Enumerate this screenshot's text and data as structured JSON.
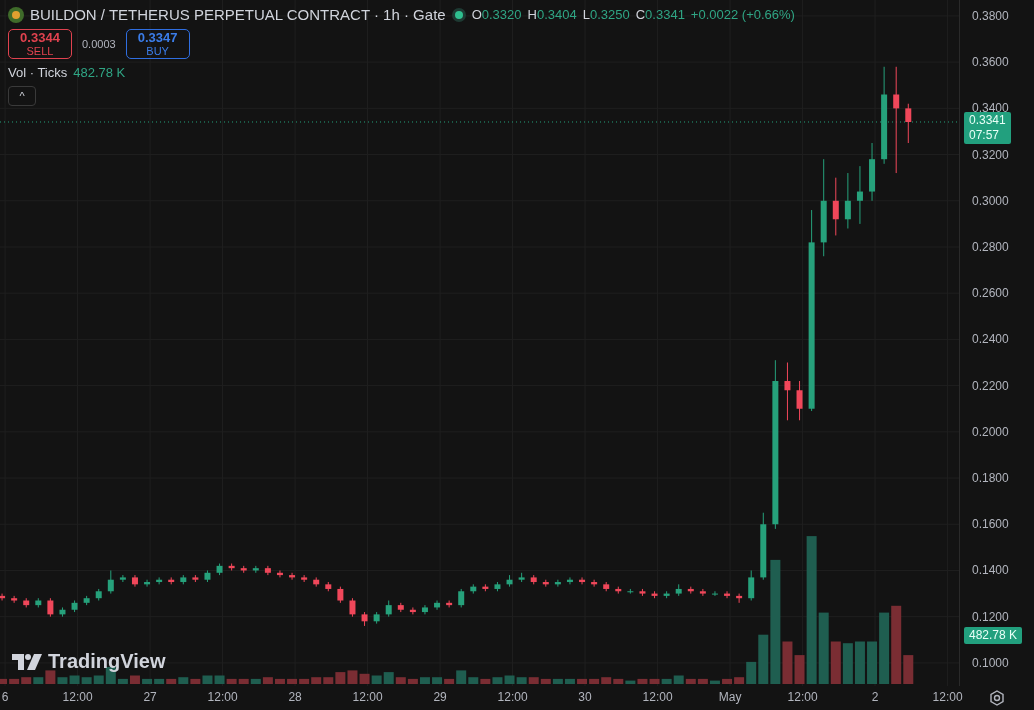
{
  "header": {
    "symbol": "BUILDON / TETHERUS PERPETUAL CONTRACT · 1h · Gate",
    "market_open": true,
    "ohlc": [
      {
        "label": "O",
        "value": "0.3320"
      },
      {
        "label": "H",
        "value": "0.3404"
      },
      {
        "label": "L",
        "value": "0.3250"
      },
      {
        "label": "C",
        "value": "0.3341"
      }
    ],
    "change": "+0.0022 (+0.66%)"
  },
  "trade": {
    "sell": {
      "price": "0.3344",
      "label": "SELL"
    },
    "spread": "0.0003",
    "buy": {
      "price": "0.3347",
      "label": "BUY"
    }
  },
  "volume_legend": {
    "label": "Vol · Ticks",
    "value": "482.78 K"
  },
  "collapse_button": "^",
  "last_price": {
    "price": "0.3341",
    "countdown": "07:57"
  },
  "volume_tag": "482.78 K",
  "watermark_brand": "TradingView",
  "time_axis": [
    "6",
    "12:00",
    "27",
    "12:00",
    "28",
    "12:00",
    "29",
    "12:00",
    "30",
    "12:00",
    "May",
    "12:00",
    "2",
    "12:00"
  ],
  "chart_data": {
    "type": "candlestick",
    "ylim": [
      0.09,
      0.3869
    ],
    "yticks": [
      {
        "value": 0.38,
        "label": "0.3800"
      },
      {
        "value": 0.36,
        "label": "0.3600"
      },
      {
        "value": 0.34,
        "label": "0.3400"
      },
      {
        "value": 0.32,
        "label": "0.3200"
      },
      {
        "value": 0.3,
        "label": "0.3000"
      },
      {
        "value": 0.28,
        "label": "0.2800"
      },
      {
        "value": 0.26,
        "label": "0.2600"
      },
      {
        "value": 0.24,
        "label": "0.2400"
      },
      {
        "value": 0.22,
        "label": "0.2200"
      },
      {
        "value": 0.2,
        "label": "0.2000"
      },
      {
        "value": 0.18,
        "label": "0.1800"
      },
      {
        "value": 0.16,
        "label": "0.1600"
      },
      {
        "value": 0.14,
        "label": "0.1400"
      },
      {
        "value": 0.12,
        "label": "0.1200"
      },
      {
        "value": 0.1,
        "label": "0.1000"
      }
    ],
    "categories": [
      null,
      null,
      null,
      null,
      null,
      null,
      null,
      null,
      null,
      null,
      null,
      null,
      null,
      null,
      null,
      null,
      null,
      null,
      null,
      null,
      null,
      null,
      null,
      null,
      null,
      null,
      null,
      null,
      null,
      null,
      null,
      null,
      null,
      null,
      null,
      null,
      null,
      null,
      null,
      null,
      null,
      null,
      null,
      null,
      null,
      null,
      null,
      null,
      null,
      null,
      null,
      null,
      null,
      null,
      null,
      null,
      null,
      null,
      null,
      null,
      null,
      null,
      null,
      null,
      null,
      null,
      null,
      null,
      null,
      null,
      null,
      null,
      null,
      null,
      null,
      null
    ],
    "ohlc": [
      [
        0.129,
        0.13,
        0.127,
        0.128
      ],
      [
        0.128,
        0.129,
        0.126,
        0.127
      ],
      [
        0.127,
        0.128,
        0.124,
        0.125
      ],
      [
        0.125,
        0.128,
        0.124,
        0.127
      ],
      [
        0.127,
        0.128,
        0.12,
        0.121
      ],
      [
        0.121,
        0.124,
        0.12,
        0.123
      ],
      [
        0.123,
        0.127,
        0.122,
        0.126
      ],
      [
        0.126,
        0.129,
        0.125,
        0.128
      ],
      [
        0.128,
        0.132,
        0.127,
        0.131
      ],
      [
        0.131,
        0.14,
        0.13,
        0.136
      ],
      [
        0.136,
        0.138,
        0.135,
        0.137
      ],
      [
        0.137,
        0.138,
        0.133,
        0.134
      ],
      [
        0.134,
        0.136,
        0.133,
        0.135
      ],
      [
        0.135,
        0.137,
        0.134,
        0.136
      ],
      [
        0.136,
        0.137,
        0.134,
        0.135
      ],
      [
        0.135,
        0.138,
        0.134,
        0.137
      ],
      [
        0.137,
        0.138,
        0.135,
        0.136
      ],
      [
        0.136,
        0.14,
        0.135,
        0.139
      ],
      [
        0.139,
        0.143,
        0.138,
        0.142
      ],
      [
        0.142,
        0.143,
        0.14,
        0.141
      ],
      [
        0.141,
        0.142,
        0.139,
        0.14
      ],
      [
        0.14,
        0.142,
        0.139,
        0.141
      ],
      [
        0.141,
        0.142,
        0.138,
        0.139
      ],
      [
        0.139,
        0.14,
        0.137,
        0.138
      ],
      [
        0.138,
        0.139,
        0.136,
        0.137
      ],
      [
        0.137,
        0.138,
        0.135,
        0.136
      ],
      [
        0.136,
        0.137,
        0.133,
        0.134
      ],
      [
        0.134,
        0.135,
        0.131,
        0.132
      ],
      [
        0.132,
        0.133,
        0.126,
        0.127
      ],
      [
        0.127,
        0.128,
        0.12,
        0.121
      ],
      [
        0.121,
        0.122,
        0.116,
        0.118
      ],
      [
        0.118,
        0.122,
        0.117,
        0.121
      ],
      [
        0.121,
        0.127,
        0.12,
        0.125
      ],
      [
        0.125,
        0.126,
        0.122,
        0.123
      ],
      [
        0.123,
        0.124,
        0.121,
        0.122
      ],
      [
        0.122,
        0.125,
        0.121,
        0.124
      ],
      [
        0.124,
        0.127,
        0.123,
        0.126
      ],
      [
        0.126,
        0.127,
        0.124,
        0.125
      ],
      [
        0.125,
        0.132,
        0.124,
        0.131
      ],
      [
        0.131,
        0.134,
        0.13,
        0.133
      ],
      [
        0.133,
        0.134,
        0.131,
        0.132
      ],
      [
        0.132,
        0.135,
        0.131,
        0.134
      ],
      [
        0.134,
        0.138,
        0.133,
        0.136
      ],
      [
        0.136,
        0.139,
        0.135,
        0.137
      ],
      [
        0.137,
        0.138,
        0.134,
        0.135
      ],
      [
        0.135,
        0.136,
        0.133,
        0.134
      ],
      [
        0.134,
        0.136,
        0.133,
        0.135
      ],
      [
        0.135,
        0.137,
        0.134,
        0.136
      ],
      [
        0.136,
        0.137,
        0.134,
        0.135
      ],
      [
        0.135,
        0.136,
        0.133,
        0.134
      ],
      [
        0.134,
        0.135,
        0.131,
        0.132
      ],
      [
        0.132,
        0.133,
        0.13,
        0.131
      ],
      [
        0.131,
        0.132,
        0.13,
        0.131
      ],
      [
        0.131,
        0.132,
        0.129,
        0.13
      ],
      [
        0.13,
        0.131,
        0.128,
        0.129
      ],
      [
        0.129,
        0.131,
        0.128,
        0.13
      ],
      [
        0.13,
        0.134,
        0.129,
        0.132
      ],
      [
        0.132,
        0.133,
        0.13,
        0.131
      ],
      [
        0.131,
        0.132,
        0.129,
        0.13
      ],
      [
        0.13,
        0.131,
        0.129,
        0.13
      ],
      [
        0.13,
        0.131,
        0.128,
        0.129
      ],
      [
        0.129,
        0.13,
        0.126,
        0.128
      ],
      [
        0.128,
        0.14,
        0.127,
        0.137
      ],
      [
        0.137,
        0.165,
        0.136,
        0.16
      ],
      [
        0.16,
        0.231,
        0.158,
        0.222
      ],
      [
        0.222,
        0.23,
        0.205,
        0.218
      ],
      [
        0.218,
        0.222,
        0.205,
        0.21
      ],
      [
        0.21,
        0.296,
        0.209,
        0.282
      ],
      [
        0.282,
        0.318,
        0.276,
        0.3
      ],
      [
        0.3,
        0.31,
        0.285,
        0.292
      ],
      [
        0.292,
        0.312,
        0.288,
        0.3
      ],
      [
        0.3,
        0.315,
        0.29,
        0.304
      ],
      [
        0.304,
        0.325,
        0.3,
        0.318
      ],
      [
        0.318,
        0.358,
        0.316,
        0.346
      ],
      [
        0.346,
        0.358,
        0.312,
        0.34
      ],
      [
        0.34,
        0.342,
        0.325,
        0.3341
      ]
    ]
  }
}
